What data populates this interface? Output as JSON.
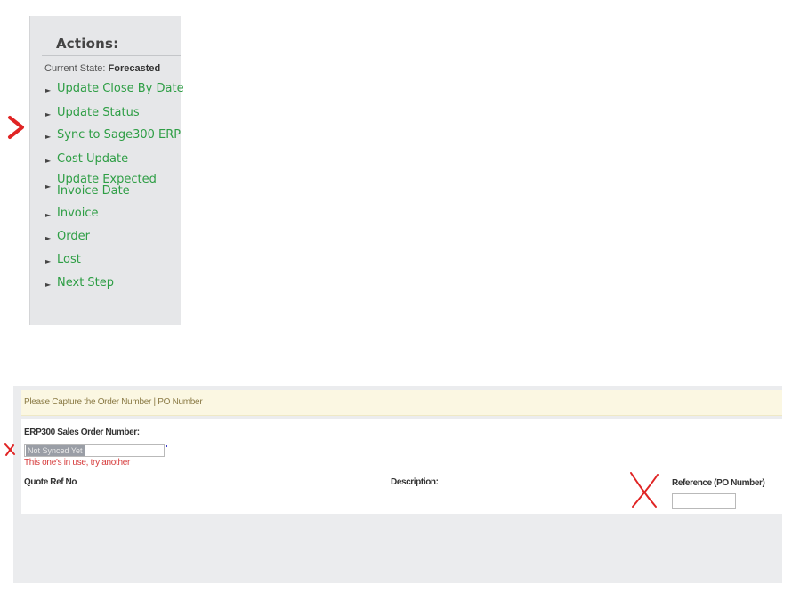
{
  "actions": {
    "title": "Actions:",
    "current_state_label": "Current State:",
    "current_state_value": "Forecasted",
    "items": [
      {
        "label": "Update Close By Date"
      },
      {
        "label": "Update Status"
      },
      {
        "label": "Sync to Sage300 ERP"
      },
      {
        "label": "Cost Update"
      },
      {
        "label": "Update Expected\nInvoice Date"
      },
      {
        "label": "Invoice"
      },
      {
        "label": "Order"
      },
      {
        "label": "Lost"
      },
      {
        "label": "Next Step"
      }
    ]
  },
  "form": {
    "header_text": "Please Capture the Order Number | PO Number",
    "erp_label": "ERP300 Sales Order Number:",
    "erp_value": "Not Synced Yet",
    "error_text": "This one's in use, try another",
    "quote_ref_label": "Quote Ref No",
    "description_label": "Description:",
    "reference_label": "Reference (PO Number)",
    "reference_value": ""
  },
  "colors": {
    "action_link": "#2e9e45",
    "error": "#d63b3b",
    "annotation": "#e02424",
    "header_bg": "#fbf7e2"
  }
}
